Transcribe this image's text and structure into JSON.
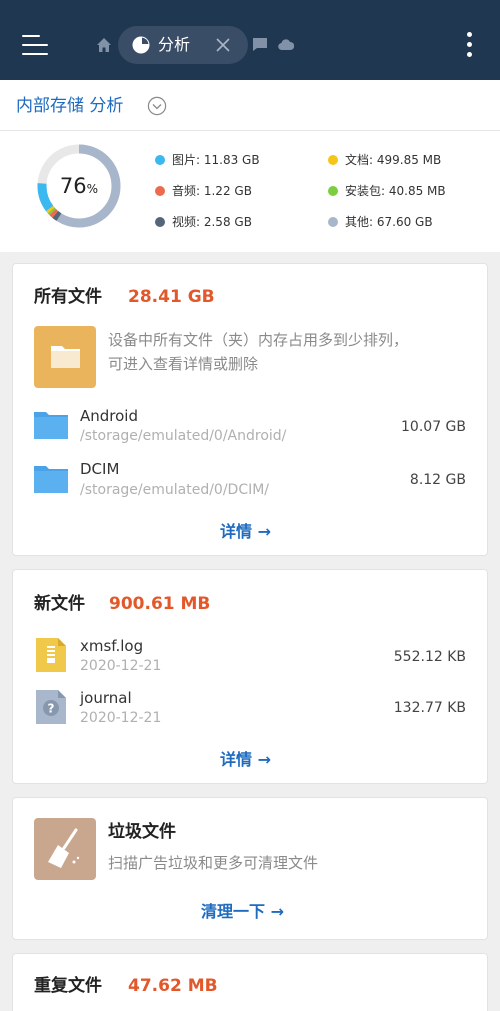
{
  "topbar": {
    "tab_label": "分析",
    "icons": [
      "menu-icon",
      "home-icon",
      "pie-chart-icon",
      "close-icon",
      "chat-icon",
      "cloud-icon",
      "more-vert-icon"
    ]
  },
  "storage": {
    "title": "内部存储 分析",
    "percent": "76",
    "percent_unit": "%",
    "used_fraction": 0.76,
    "legend": [
      {
        "label": "图片: 11.83 GB",
        "color": "#3bb8ef"
      },
      {
        "label": "文档: 499.85 MB",
        "color": "#f5c518"
      },
      {
        "label": "音频: 1.22 GB",
        "color": "#ec6b4f"
      },
      {
        "label": "安装包: 40.85 MB",
        "color": "#7ccd3f"
      },
      {
        "label": "视频: 2.58 GB",
        "color": "#55657a"
      },
      {
        "label": "其他: 67.60 GB",
        "color": "#a8b6cb"
      }
    ]
  },
  "all_files": {
    "title": "所有文件",
    "size": "28.41 GB",
    "desc_line1": "设备中所有文件（夹）内存占用多到少排列，",
    "desc_line2": "可进入查看详情或删除",
    "rows": [
      {
        "name": "Android",
        "path": "/storage/emulated/0/Android/",
        "size": "10.07 GB"
      },
      {
        "name": "DCIM",
        "path": "/storage/emulated/0/DCIM/",
        "size": "8.12 GB"
      }
    ],
    "link": "详情 →"
  },
  "new_files": {
    "title": "新文件",
    "size": "900.61 MB",
    "rows": [
      {
        "name": "xmsf.log",
        "date": "2020-12-21",
        "size": "552.12 KB"
      },
      {
        "name": "journal",
        "date": "2020-12-21",
        "size": "132.77 KB"
      }
    ],
    "link": "详情 →"
  },
  "junk": {
    "title": "垃圾文件",
    "desc": "扫描广告垃圾和更多可清理文件",
    "link": "清理一下 →"
  },
  "duplicates": {
    "title": "重复文件",
    "size": "47.62 MB"
  },
  "colors": {
    "topbar": "#203752",
    "accent_blue": "#1e6bc0",
    "size_orange": "#e2582a",
    "folder_blue": "#4aa3e8",
    "folder_orange": "#e9b45c"
  }
}
